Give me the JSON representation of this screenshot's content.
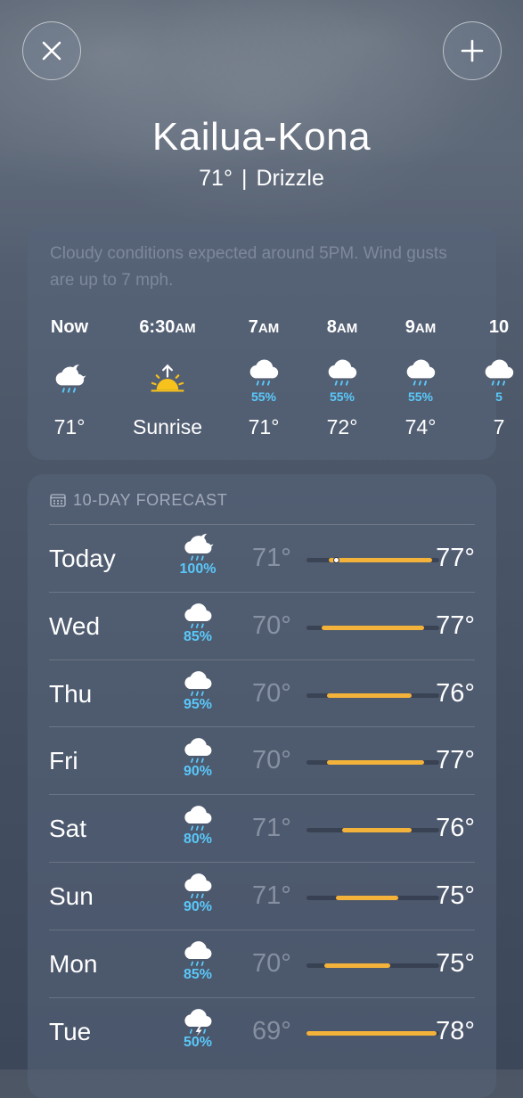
{
  "header": {
    "city": "Kailua-Kona",
    "temp": "71°",
    "separator": "|",
    "condition": "Drizzle"
  },
  "controls": {
    "close_icon": "close-icon",
    "add_icon": "plus-icon"
  },
  "summary": "Cloudy conditions expected around 5PM. Wind gusts are up to 7 mph.",
  "hourly": [
    {
      "time": "Now",
      "suffix": "",
      "icon": "night-cloud-rain",
      "pct": "",
      "value": "71°"
    },
    {
      "time": "6:30",
      "suffix": "AM",
      "icon": "sunrise",
      "pct": "",
      "value": "Sunrise"
    },
    {
      "time": "7",
      "suffix": "AM",
      "icon": "cloud-drizzle",
      "pct": "55%",
      "value": "71°"
    },
    {
      "time": "8",
      "suffix": "AM",
      "icon": "cloud-drizzle",
      "pct": "55%",
      "value": "72°"
    },
    {
      "time": "9",
      "suffix": "AM",
      "icon": "cloud-drizzle",
      "pct": "55%",
      "value": "74°"
    },
    {
      "time": "10",
      "suffix": "",
      "icon": "cloud-drizzle",
      "pct": "5",
      "value": "7"
    }
  ],
  "forecast": {
    "title": "10-DAY FORECAST",
    "range_min": 69,
    "range_max": 78,
    "days": [
      {
        "day": "Today",
        "icon": "night-cloud-rain",
        "pct": "100%",
        "low": "71°",
        "high": "77°",
        "low_val": 70.5,
        "high_val": 77.5,
        "current": 71
      },
      {
        "day": "Wed",
        "icon": "cloud-drizzle",
        "pct": "85%",
        "low": "70°",
        "high": "77°",
        "low_val": 70,
        "high_val": 77,
        "current": null
      },
      {
        "day": "Thu",
        "icon": "cloud-drizzle",
        "pct": "95%",
        "low": "70°",
        "high": "76°",
        "low_val": 70.4,
        "high_val": 76.1,
        "current": null
      },
      {
        "day": "Fri",
        "icon": "cloud-drizzle",
        "pct": "90%",
        "low": "70°",
        "high": "77°",
        "low_val": 70.4,
        "high_val": 77,
        "current": null
      },
      {
        "day": "Sat",
        "icon": "cloud-drizzle",
        "pct": "80%",
        "low": "71°",
        "high": "76°",
        "low_val": 71.4,
        "high_val": 76.1,
        "current": null
      },
      {
        "day": "Sun",
        "icon": "cloud-drizzle",
        "pct": "90%",
        "low": "71°",
        "high": "75°",
        "low_val": 71,
        "high_val": 75.2,
        "current": null
      },
      {
        "day": "Mon",
        "icon": "cloud-drizzle",
        "pct": "85%",
        "low": "70°",
        "high": "75°",
        "low_val": 70.2,
        "high_val": 74.7,
        "current": null
      },
      {
        "day": "Tue",
        "icon": "cloud-thunder-rain",
        "pct": "50%",
        "low": "69°",
        "high": "78°",
        "low_val": 69,
        "high_val": 77.8,
        "current": null
      }
    ]
  },
  "colors": {
    "accent_rain": "#5ac8fa",
    "bar_fill": "#f3b23a",
    "sun": "#f7c21b"
  }
}
